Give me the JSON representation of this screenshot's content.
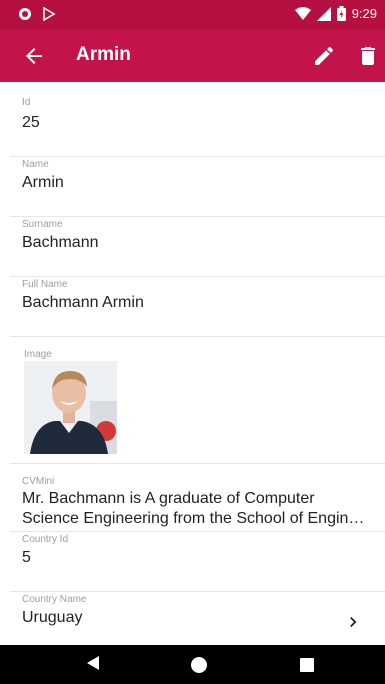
{
  "status_bar": {
    "time": "9:29"
  },
  "app_bar": {
    "title": "Armin"
  },
  "fields": {
    "id": {
      "label": "Id",
      "value": "25"
    },
    "name": {
      "label": "Name",
      "value": "Armin"
    },
    "surname": {
      "label": "Surname",
      "value": "Bachmann"
    },
    "full_name": {
      "label": "Full Name",
      "value": "Bachmann Armin"
    },
    "image": {
      "label": "Image"
    },
    "cvmini": {
      "label": "CVMini",
      "value": "Mr. Bachmann is A graduate of Computer Science Engineering from the School of Engin…"
    },
    "country_id": {
      "label": "Country Id",
      "value": "5"
    },
    "country_name": {
      "label": "Country Name",
      "value": "Uruguay"
    }
  },
  "icons": {
    "back": "arrow-back-icon",
    "edit": "pencil-icon",
    "delete": "trash-icon",
    "chevron": "chevron-right-icon"
  },
  "colors": {
    "status_bar": "#b5103f",
    "app_bar": "#c2134a"
  }
}
